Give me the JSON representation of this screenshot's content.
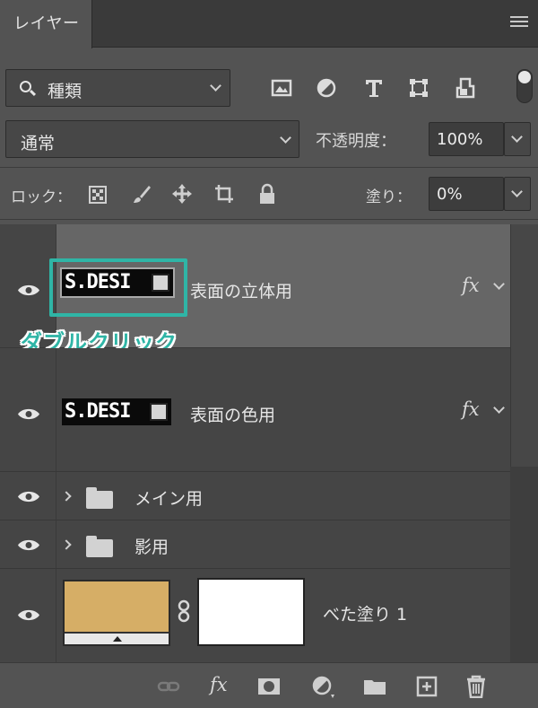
{
  "panel": {
    "tab_label": "レイヤー",
    "menu_icon": "hamburger-menu-icon"
  },
  "filter": {
    "kind_label": "種類",
    "icons": [
      "image-filter-icon",
      "adjustment-filter-icon",
      "type-filter-icon",
      "shape-filter-icon",
      "smart-object-filter-icon"
    ]
  },
  "blend": {
    "mode": "通常",
    "opacity_label": "不透明度：",
    "opacity_value": "100%"
  },
  "lock": {
    "label": "ロック：",
    "fill_label": "塗り：",
    "fill_value": "0%",
    "icons": [
      "lock-transparent-pixels-icon",
      "lock-image-pixels-icon",
      "lock-position-icon",
      "lock-artboard-icon",
      "lock-all-icon"
    ]
  },
  "layers": [
    {
      "type": "text",
      "name": "表面の立体用",
      "thumb_text": "S.DESI",
      "fx": "fx",
      "selected": true
    },
    {
      "type": "text",
      "name": "表面の色用",
      "thumb_text": "S.DESI",
      "fx": "fx",
      "selected": false
    },
    {
      "type": "group",
      "name": "メイン用"
    },
    {
      "type": "group",
      "name": "影用"
    },
    {
      "type": "fill",
      "name": "べた塗り 1",
      "fill_color": "#d6ae66",
      "mask_color": "#ffffff"
    }
  ],
  "annotation": {
    "callout_text": "ダブルクリック",
    "color": "#2fb5a6"
  },
  "bottom_icons": [
    "link-layers-icon",
    "fx-icon",
    "add-mask-icon",
    "adjustment-layer-icon",
    "new-group-icon",
    "new-layer-icon",
    "delete-layer-icon"
  ],
  "bottom": {
    "fx_label": "fx"
  }
}
